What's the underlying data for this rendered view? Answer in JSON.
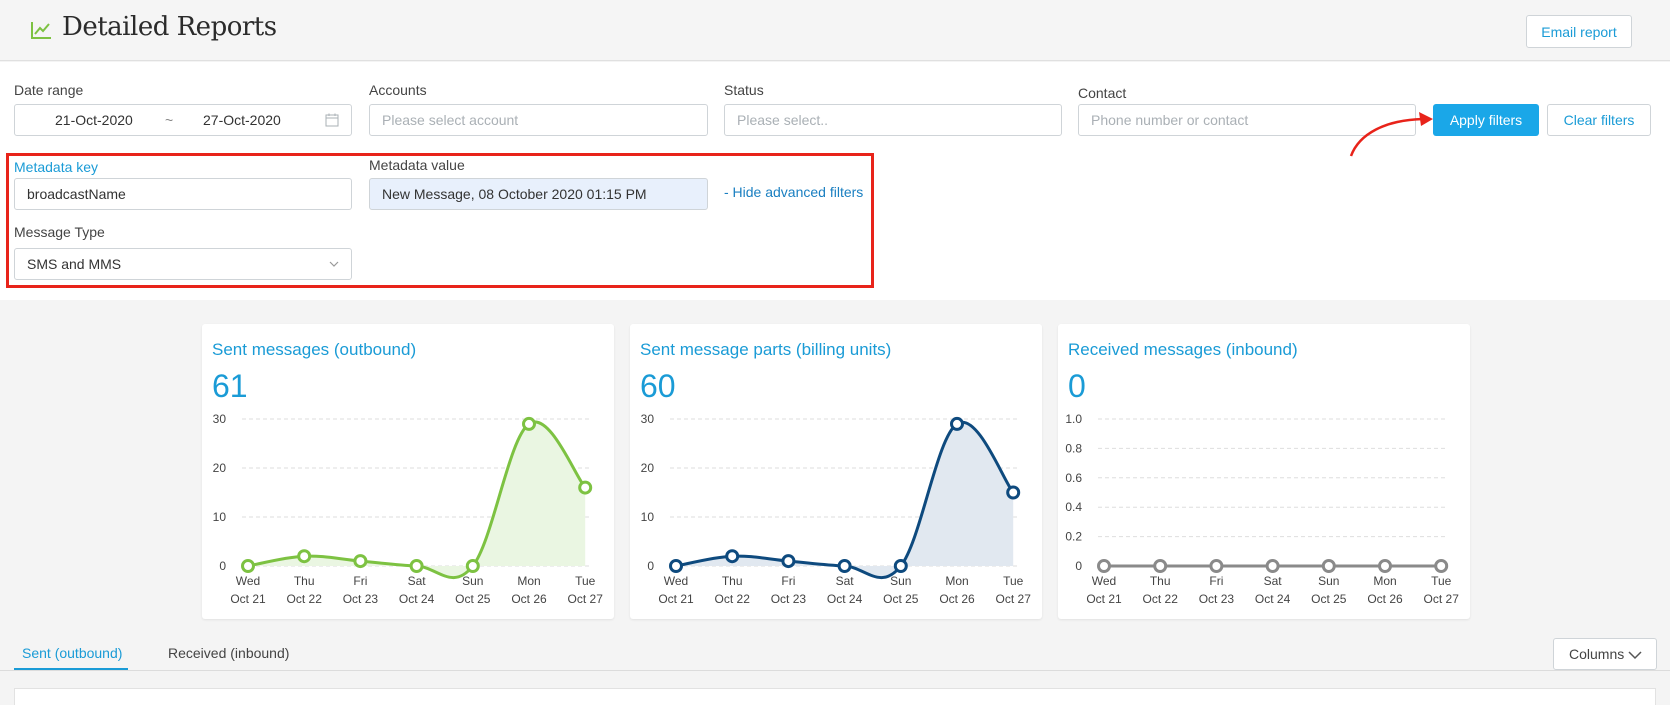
{
  "header": {
    "title": "Detailed Reports",
    "email_report_label": "Email report"
  },
  "filters": {
    "date_range": {
      "label": "Date range",
      "start": "21-Oct-2020",
      "separator": "~",
      "end": "27-Oct-2020"
    },
    "accounts": {
      "label": "Accounts",
      "placeholder": "Please select account"
    },
    "status": {
      "label": "Status",
      "placeholder": "Please select.."
    },
    "contact": {
      "label": "Contact",
      "placeholder": "Phone number or contact"
    },
    "apply_label": "Apply filters",
    "clear_label": "Clear filters",
    "metadata_key": {
      "label": "Metadata key",
      "value": "broadcastName"
    },
    "metadata_value": {
      "label": "Metadata value",
      "value": "New Message, 08 October 2020 01:15 PM"
    },
    "hide_advanced_label": "- Hide advanced filters",
    "message_type": {
      "label": "Message Type",
      "value": "SMS and MMS"
    }
  },
  "annotation": {
    "box_color": "#e8231a",
    "arrow_color": "#e8231a"
  },
  "cards": [
    {
      "title": "Sent messages (outbound)",
      "total": "61"
    },
    {
      "title": "Sent message parts (billing units)",
      "total": "60"
    },
    {
      "title": "Received messages (inbound)",
      "total": "0"
    }
  ],
  "chart_data": [
    {
      "type": "area",
      "categories": [
        "Wed Oct 21",
        "Thu Oct 22",
        "Fri Oct 23",
        "Sat Oct 24",
        "Sun Oct 25",
        "Mon Oct 26",
        "Tue Oct 27"
      ],
      "day_labels": [
        "Wed",
        "Thu",
        "Fri",
        "Sat",
        "Sun",
        "Mon",
        "Tue"
      ],
      "date_labels": [
        "Oct 21",
        "Oct 22",
        "Oct 23",
        "Oct 24",
        "Oct 25",
        "Oct 26",
        "Oct 27"
      ],
      "values": [
        0,
        2,
        1,
        0,
        0,
        29,
        16
      ],
      "ylim": [
        0,
        30
      ],
      "yticks": [
        "0",
        "10",
        "20",
        "30"
      ],
      "grid": true,
      "color": "#7dc242",
      "fill": "#eaf6e2"
    },
    {
      "type": "area",
      "categories": [
        "Wed Oct 21",
        "Thu Oct 22",
        "Fri Oct 23",
        "Sat Oct 24",
        "Sun Oct 25",
        "Mon Oct 26",
        "Tue Oct 27"
      ],
      "day_labels": [
        "Wed",
        "Thu",
        "Fri",
        "Sat",
        "Sun",
        "Mon",
        "Tue"
      ],
      "date_labels": [
        "Oct 21",
        "Oct 22",
        "Oct 23",
        "Oct 24",
        "Oct 25",
        "Oct 26",
        "Oct 27"
      ],
      "values": [
        0,
        2,
        1,
        0,
        0,
        29,
        15
      ],
      "ylim": [
        0,
        30
      ],
      "yticks": [
        "0",
        "10",
        "20",
        "30"
      ],
      "grid": true,
      "color": "#0e4a7e",
      "fill": "#e1e8f0"
    },
    {
      "type": "line",
      "categories": [
        "Wed Oct 21",
        "Thu Oct 22",
        "Fri Oct 23",
        "Sat Oct 24",
        "Sun Oct 25",
        "Mon Oct 26",
        "Tue Oct 27"
      ],
      "day_labels": [
        "Wed",
        "Thu",
        "Fri",
        "Sat",
        "Sun",
        "Mon",
        "Tue"
      ],
      "date_labels": [
        "Oct 21",
        "Oct 22",
        "Oct 23",
        "Oct 24",
        "Oct 25",
        "Oct 26",
        "Oct 27"
      ],
      "values": [
        0,
        0,
        0,
        0,
        0,
        0,
        0
      ],
      "ylim": [
        0,
        1
      ],
      "yticks": [
        "0",
        "0.2",
        "0.4",
        "0.6",
        "0.8",
        "1.0"
      ],
      "grid": true,
      "color": "#8a8a8a",
      "fill": "none"
    }
  ],
  "tabs": {
    "sent_label": "Sent (outbound)",
    "received_label": "Received (inbound)"
  },
  "columns_label": "Columns"
}
